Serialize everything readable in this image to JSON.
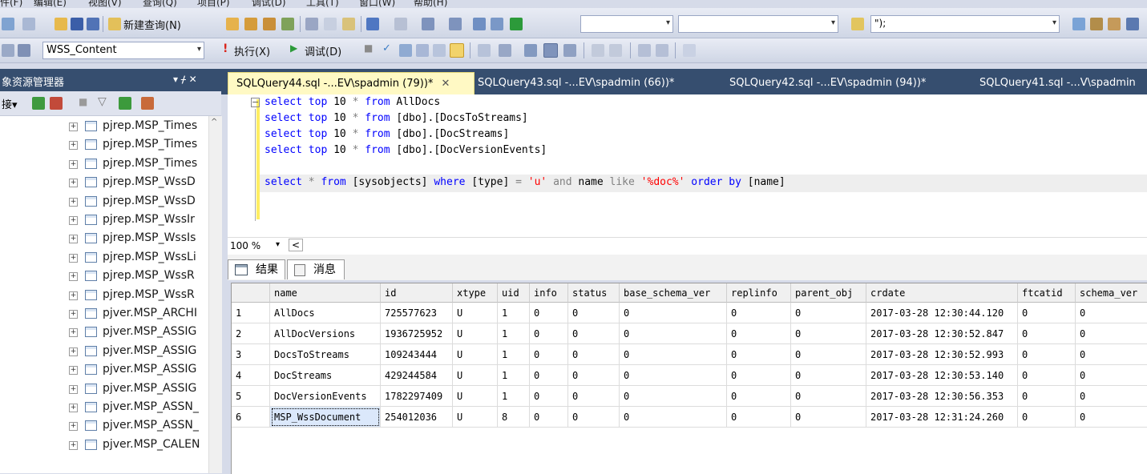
{
  "menu": [
    "件(F)",
    "编辑(E)",
    "视图(V)",
    "查询(Q)",
    "项目(P)",
    "调试(D)",
    "工具(T)",
    "窗口(W)",
    "帮助(H)"
  ],
  "toolbar1": {
    "new_query": "新建查询(N)",
    "search_combo_value": "\");"
  },
  "toolbar2": {
    "database": "WSS_Content",
    "execute": "执行(X)",
    "debug": "调试(D)"
  },
  "object_explorer": {
    "title": "象资源管理器",
    "pin": "▾ ᚋ ✕",
    "connect": "接▾",
    "items": [
      "pjrep.MSP_Times",
      "pjrep.MSP_Times",
      "pjrep.MSP_Times",
      "pjrep.MSP_WssD",
      "pjrep.MSP_WssD",
      "pjrep.MSP_WssIr",
      "pjrep.MSP_WssIs",
      "pjrep.MSP_WssLi",
      "pjrep.MSP_WssR",
      "pjrep.MSP_WssR",
      "pjver.MSP_ARCHI",
      "pjver.MSP_ASSIG",
      "pjver.MSP_ASSIG",
      "pjver.MSP_ASSIG",
      "pjver.MSP_ASSIG",
      "pjver.MSP_ASSN_",
      "pjver.MSP_ASSN_",
      "pjver.MSP_CALEN"
    ]
  },
  "doc_tabs": [
    {
      "label": "SQLQuery44.sql -...EV\\spadmin (79))*",
      "active": true
    },
    {
      "label": "SQLQuery43.sql -...EV\\spadmin (66))*",
      "active": false
    },
    {
      "label": "SQLQuery42.sql -...EV\\spadmin (94))*",
      "active": false
    },
    {
      "label": "SQLQuery41.sql -...V\\spadmin",
      "active": false
    }
  ],
  "editor": {
    "lines": [
      {
        "kw1": "select",
        "kw2": "top",
        "num": "10",
        "star": "*",
        "kw3": "from",
        "obj": "AllDocs"
      },
      {
        "kw1": "select",
        "kw2": "top",
        "num": "10",
        "star": "*",
        "kw3": "from",
        "obj": "[dbo].[DocsToStreams]"
      },
      {
        "kw1": "select",
        "kw2": "top",
        "num": "10",
        "star": "*",
        "kw3": "from",
        "obj": "[dbo].[DocStreams]"
      },
      {
        "kw1": "select",
        "kw2": "top",
        "num": "10",
        "star": "*",
        "kw3": "from",
        "obj": "[dbo].[DocVersionEvents]"
      }
    ],
    "query5": {
      "select": "select",
      "star": "*",
      "from": "from",
      "table": "[sysobjects]",
      "where": "where",
      "col": "[type]",
      "eq": "=",
      "val": "'u'",
      "and": "and",
      "name": "name",
      "like": "like",
      "pattern": "'%doc%'",
      "order": "order by",
      "ordcol": "[name]"
    }
  },
  "zoom": "100 %",
  "result_tabs": {
    "results": "结果",
    "messages": "消息"
  },
  "grid": {
    "columns": [
      "name",
      "id",
      "xtype",
      "uid",
      "info",
      "status",
      "base_schema_ver",
      "replinfo",
      "parent_obj",
      "crdate",
      "ftcatid",
      "schema_ver"
    ],
    "rows": [
      [
        "1",
        "AllDocs",
        "725577623",
        "U",
        "1",
        "0",
        "0",
        "0",
        "0",
        "0",
        "2017-03-28 12:30:44.120",
        "0",
        "0"
      ],
      [
        "2",
        "AllDocVersions",
        "1936725952",
        "U",
        "1",
        "0",
        "0",
        "0",
        "0",
        "0",
        "2017-03-28 12:30:52.847",
        "0",
        "0"
      ],
      [
        "3",
        "DocsToStreams",
        "109243444",
        "U",
        "1",
        "0",
        "0",
        "0",
        "0",
        "0",
        "2017-03-28 12:30:52.993",
        "0",
        "0"
      ],
      [
        "4",
        "DocStreams",
        "429244584",
        "U",
        "1",
        "0",
        "0",
        "0",
        "0",
        "0",
        "2017-03-28 12:30:53.140",
        "0",
        "0"
      ],
      [
        "5",
        "DocVersionEvents",
        "1782297409",
        "U",
        "1",
        "0",
        "0",
        "0",
        "0",
        "0",
        "2017-03-28 12:30:56.353",
        "0",
        "0"
      ],
      [
        "6",
        "MSP_WssDocument",
        "254012036",
        "U",
        "8",
        "0",
        "0",
        "0",
        "0",
        "0",
        "2017-03-28 12:31:24.260",
        "0",
        "0"
      ]
    ]
  },
  "colors": {
    "window_bg": "#d6dbe9",
    "title_bar": "#364e6f",
    "active_tab": "#fff9c4",
    "keyword": "#0000ff",
    "string": "#ff0000"
  }
}
